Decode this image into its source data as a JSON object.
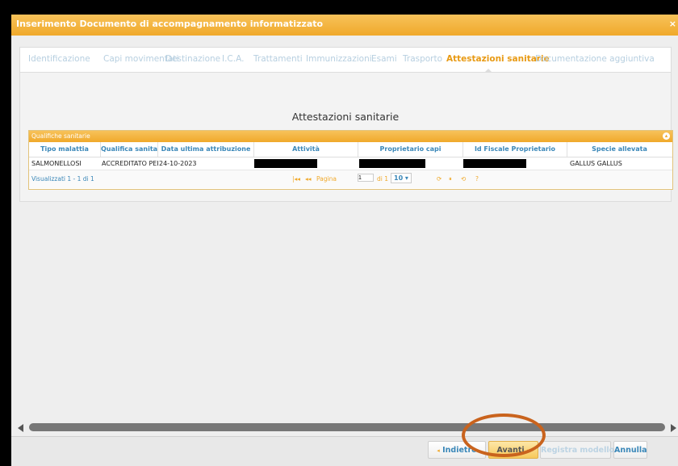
{
  "window": {
    "title": "Inserimento Documento di accompagnamento informatizzato",
    "close_label": "×"
  },
  "tabs": [
    {
      "label": "Identificazione",
      "active": false
    },
    {
      "label": "Capi movimentati",
      "active": false
    },
    {
      "label": "Destinazione",
      "active": false
    },
    {
      "label": "I.C.A.",
      "active": false
    },
    {
      "label": "Trattamenti",
      "active": false
    },
    {
      "label": "Immunizzazioni",
      "active": false
    },
    {
      "label": "Esami",
      "active": false
    },
    {
      "label": "Trasporto",
      "active": false
    },
    {
      "label": "Attestazioni sanitarie",
      "active": true
    },
    {
      "label": "Documentazione aggiuntiva",
      "active": false
    }
  ],
  "section_title": "Attestazioni sanitarie",
  "grid": {
    "caption": "Qualifiche sanitarie",
    "columns": [
      "Tipo malattia",
      "Qualifica sanitaria",
      "Data ultima attribuzione",
      "Attività",
      "Proprietario capi",
      "Id Fiscale Proprietario",
      "Specie allevata"
    ],
    "rows": [
      {
        "tipo_malattia": "SALMONELLOSI",
        "qualifica": "ACCREDITATO PER II",
        "data": "24-10-2023",
        "specie": "GALLUS GALLUS"
      }
    ],
    "pager": {
      "info": "Visualizzati 1 - 1 di 1",
      "first": "|◂◂",
      "prev": "◂◂",
      "page_label": "Pagina",
      "page_value": "1",
      "of_label": "di 1",
      "next": "▸▸",
      "last": "▸▸|",
      "page_size": "10 ▾",
      "tools": [
        "⟳",
        "⏸",
        "⟲",
        "?"
      ]
    }
  },
  "buttons": {
    "back": "Indietro",
    "next": "Avanti",
    "save_model": "Registra modello",
    "cancel": "Annulla"
  },
  "colors": {
    "accent": "#f0a92b",
    "link": "#3a87b8",
    "highlight_ring": "#c9631d"
  }
}
